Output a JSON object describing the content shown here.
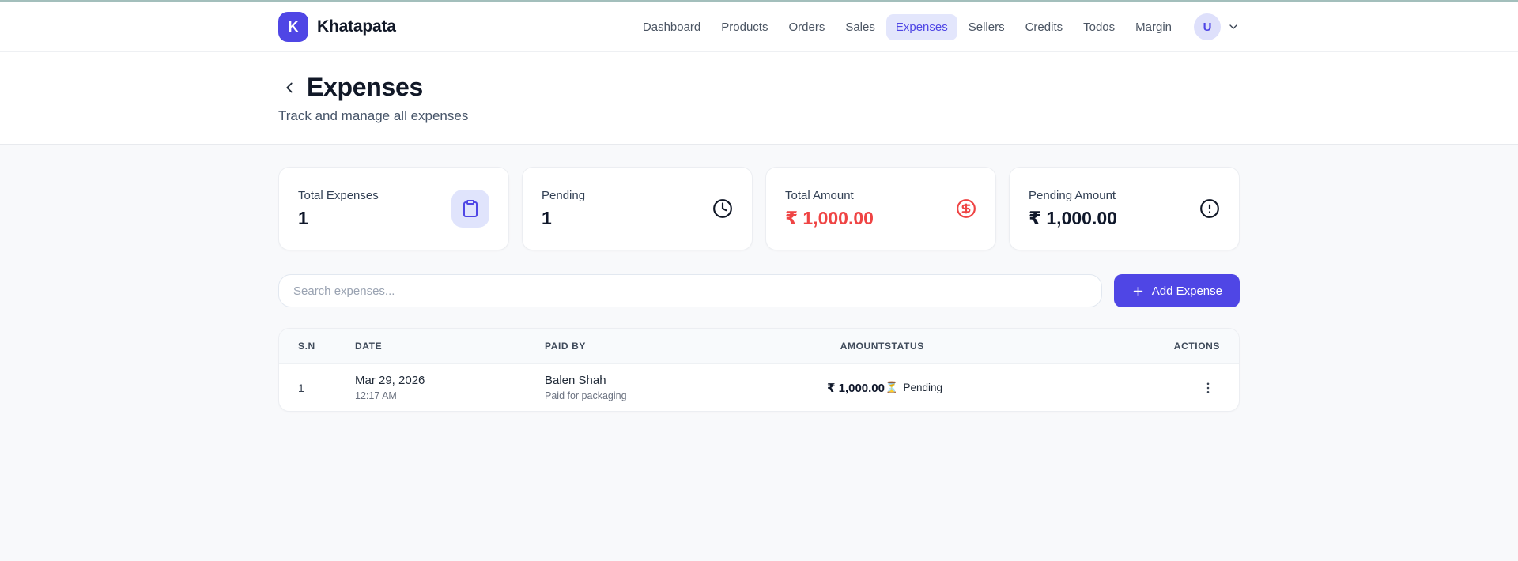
{
  "brand": {
    "logo_letter": "K",
    "name": "Khatapata"
  },
  "nav": {
    "items": [
      {
        "label": "Dashboard",
        "active": false
      },
      {
        "label": "Products",
        "active": false
      },
      {
        "label": "Orders",
        "active": false
      },
      {
        "label": "Sales",
        "active": false
      },
      {
        "label": "Expenses",
        "active": true
      },
      {
        "label": "Sellers",
        "active": false
      },
      {
        "label": "Credits",
        "active": false
      },
      {
        "label": "Todos",
        "active": false
      },
      {
        "label": "Margin",
        "active": false
      }
    ],
    "avatar_initial": "U"
  },
  "page": {
    "title": "Expenses",
    "subtitle": "Track and manage all expenses"
  },
  "cards": [
    {
      "label": "Total Expenses",
      "value": "1",
      "icon": "clipboard-icon"
    },
    {
      "label": "Pending",
      "value": "1",
      "icon": "clock-icon"
    },
    {
      "label": "Total Amount",
      "value": "₹ 1,000.00",
      "icon": "dollar-circle-icon",
      "value_color": "#ef4444"
    },
    {
      "label": "Pending Amount",
      "value": "₹ 1,000.00",
      "icon": "alert-circle-icon"
    }
  ],
  "toolbar": {
    "search_placeholder": "Search expenses...",
    "add_button_label": "Add Expense"
  },
  "table": {
    "headers": [
      "S.N",
      "DATE",
      "PAID BY",
      "AMOUNT",
      "STATUS",
      "ACTIONS"
    ],
    "rows": [
      {
        "sn": "1",
        "date": "Mar 29, 2026",
        "time": "12:17 AM",
        "paid_by": "Balen Shah",
        "note": "Paid for packaging",
        "amount": "₹ 1,000.00",
        "status_icon": "⏳",
        "status": "Pending"
      }
    ]
  },
  "colors": {
    "accent": "#4f46e5",
    "accent_light": "#e0e4fc",
    "danger": "#ef4444",
    "top_line": "#a3bfbc",
    "page_bg": "#f8f9fb"
  }
}
